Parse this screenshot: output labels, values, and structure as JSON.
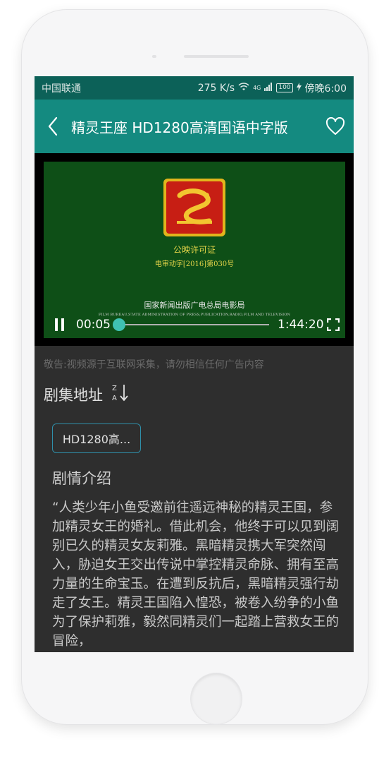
{
  "status_bar": {
    "carrier": "中国联通",
    "speed": "275 K/s",
    "network": "4G",
    "battery": "100",
    "time": "傍晚6:00"
  },
  "app_bar": {
    "title": "精灵王座 HD1280高清国语中字版"
  },
  "video": {
    "frame": {
      "cert_title": "公映许可证",
      "cert_number": "电审动字[2016]第030号",
      "bureau_cn": "国家新闻出版广电总局电影局",
      "bureau_en": "FILM BUREAU,STATE ADMINISTRATION OF PRESS,PUBLICATION,RADIO,FILM AND TELEVISION"
    },
    "current_time": "00:05",
    "duration": "1:44:20",
    "progress": 0.003,
    "accent_color": "#3fc1b3"
  },
  "disclaimer": "敬告:视频源于互联网采集，请勿相信任何广告内容",
  "episodes": {
    "heading": "剧集地址",
    "items": [
      "HD1280高..."
    ]
  },
  "synopsis": {
    "heading": "剧情介绍",
    "text": "“人类少年小鱼受邀前往遥远神秘的精灵王国，参加精灵女王的婚礼。借此机会，他终于可以见到阔别已久的精灵女友莉雅。黑暗精灵携大军突然闯入，胁迫女王交出传说中掌控精灵命脉、拥有至高力量的生命宝玉。在遭到反抗后，黑暗精灵强行劫走了女王。精灵王国陷入惶恐，被卷入纷争的小鱼为了保护莉雅，毅然同精灵们一起踏上营救女王的冒险，"
  },
  "colors": {
    "status_bar_bg": "#0c6158",
    "app_bar_bg": "#148a80",
    "content_bg": "#2e2e2e",
    "chip_border": "#2f8fa9"
  }
}
